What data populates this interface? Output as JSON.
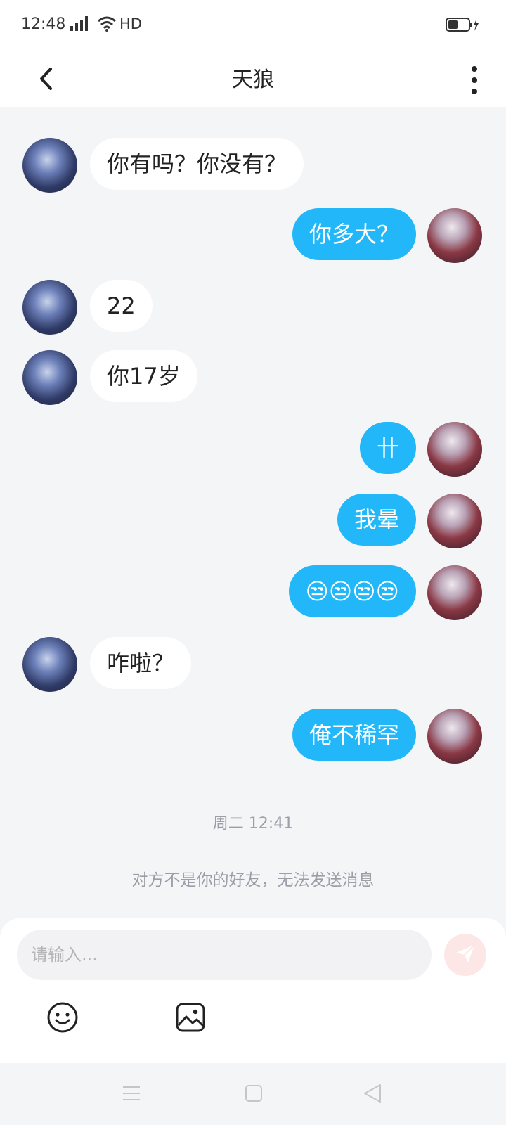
{
  "status_bar": {
    "time": "12:48",
    "network": "HD"
  },
  "header": {
    "title": "天狼"
  },
  "messages": [
    {
      "side": "left",
      "text": "你有吗？你没有？"
    },
    {
      "side": "right",
      "text": "你多大？"
    },
    {
      "side": "left",
      "text": "22"
    },
    {
      "side": "left",
      "text": "你17岁"
    },
    {
      "side": "right",
      "text": "卄"
    },
    {
      "side": "right",
      "text": "我晕"
    },
    {
      "side": "right",
      "text": "😒😒😒😒"
    },
    {
      "side": "left",
      "text": "咋啦？"
    },
    {
      "side": "right",
      "text": "俺不稀罕"
    }
  ],
  "timestamp": "周二 12:41",
  "notice": "对方不是你的好友，无法发送消息",
  "input": {
    "placeholder": "请输入...",
    "value": ""
  },
  "colors": {
    "accent": "#22b7f9",
    "background": "#f4f5f7",
    "send_disabled": "#fde6e6"
  },
  "icons": [
    "back-arrow-icon",
    "more-vertical-icon",
    "emoji-icon",
    "image-icon",
    "send-icon"
  ]
}
